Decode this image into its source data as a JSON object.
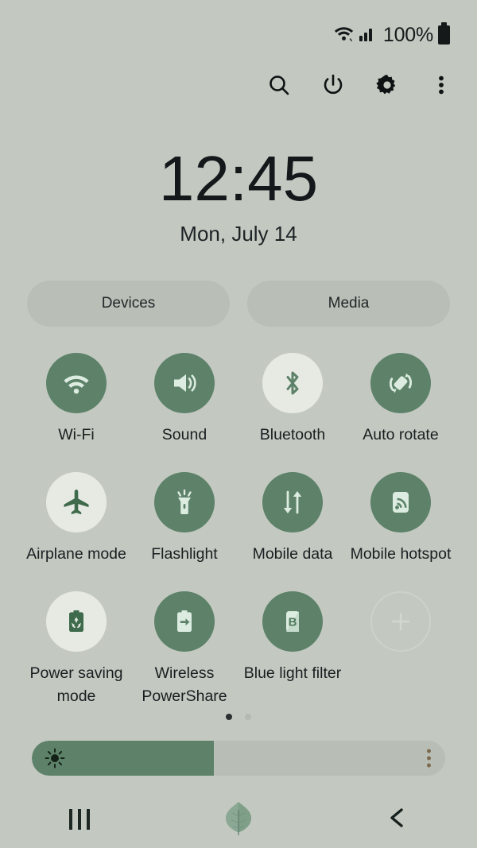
{
  "status_bar": {
    "wifi_icon": "wifi-data-icon",
    "signal_icon": "cellular-signal-icon",
    "battery_percent": "100%",
    "battery_icon": "battery-full-icon"
  },
  "header": {
    "icons": [
      {
        "name": "search-icon",
        "label": "Search"
      },
      {
        "name": "power-icon",
        "label": "Power off"
      },
      {
        "name": "settings-icon",
        "label": "Settings"
      },
      {
        "name": "more-icon",
        "label": "More options"
      }
    ]
  },
  "clock": {
    "time": "12:45",
    "date": "Mon, July 14"
  },
  "pills": [
    {
      "label": "Devices"
    },
    {
      "label": "Media"
    }
  ],
  "toggles": [
    {
      "label": "Wi-Fi",
      "icon": "wifi-icon",
      "state": "on"
    },
    {
      "label": "Sound",
      "icon": "sound-icon",
      "state": "on"
    },
    {
      "label": "Bluetooth",
      "icon": "bluetooth-icon",
      "state": "off"
    },
    {
      "label": "Auto rotate",
      "icon": "auto-rotate-icon",
      "state": "on"
    },
    {
      "label": "Airplane mode",
      "icon": "airplane-icon",
      "state": "off"
    },
    {
      "label": "Flashlight",
      "icon": "flashlight-icon",
      "state": "on"
    },
    {
      "label": "Mobile data",
      "icon": "mobile-data-icon",
      "state": "on"
    },
    {
      "label": "Mobile hotspot",
      "icon": "mobile-hotspot-icon",
      "state": "on"
    },
    {
      "label": "Power saving mode",
      "icon": "power-saving-icon",
      "state": "off"
    },
    {
      "label": "Wireless PowerShare",
      "icon": "power-share-icon",
      "state": "on"
    },
    {
      "label": "Blue light filter",
      "icon": "blue-light-icon",
      "state": "on"
    },
    {
      "label": "",
      "icon": "add-icon",
      "state": "add"
    }
  ],
  "pagination": {
    "total": 2,
    "active_index": 0
  },
  "brightness": {
    "percent": 44,
    "sun_icon": "brightness-sun-icon",
    "menu_icon": "brightness-more-icon"
  },
  "nav_bar": [
    {
      "name": "recents-button",
      "icon": "recents-icon"
    },
    {
      "name": "home-button",
      "icon": "leaf-home-icon"
    },
    {
      "name": "back-button",
      "icon": "back-chevron-icon"
    }
  ],
  "colors": {
    "background": "#c3c9c1",
    "accent_green": "#5d8269",
    "inactive_circle": "#e7eae3",
    "pill": "#b9bfb6",
    "text": "#191e20"
  }
}
